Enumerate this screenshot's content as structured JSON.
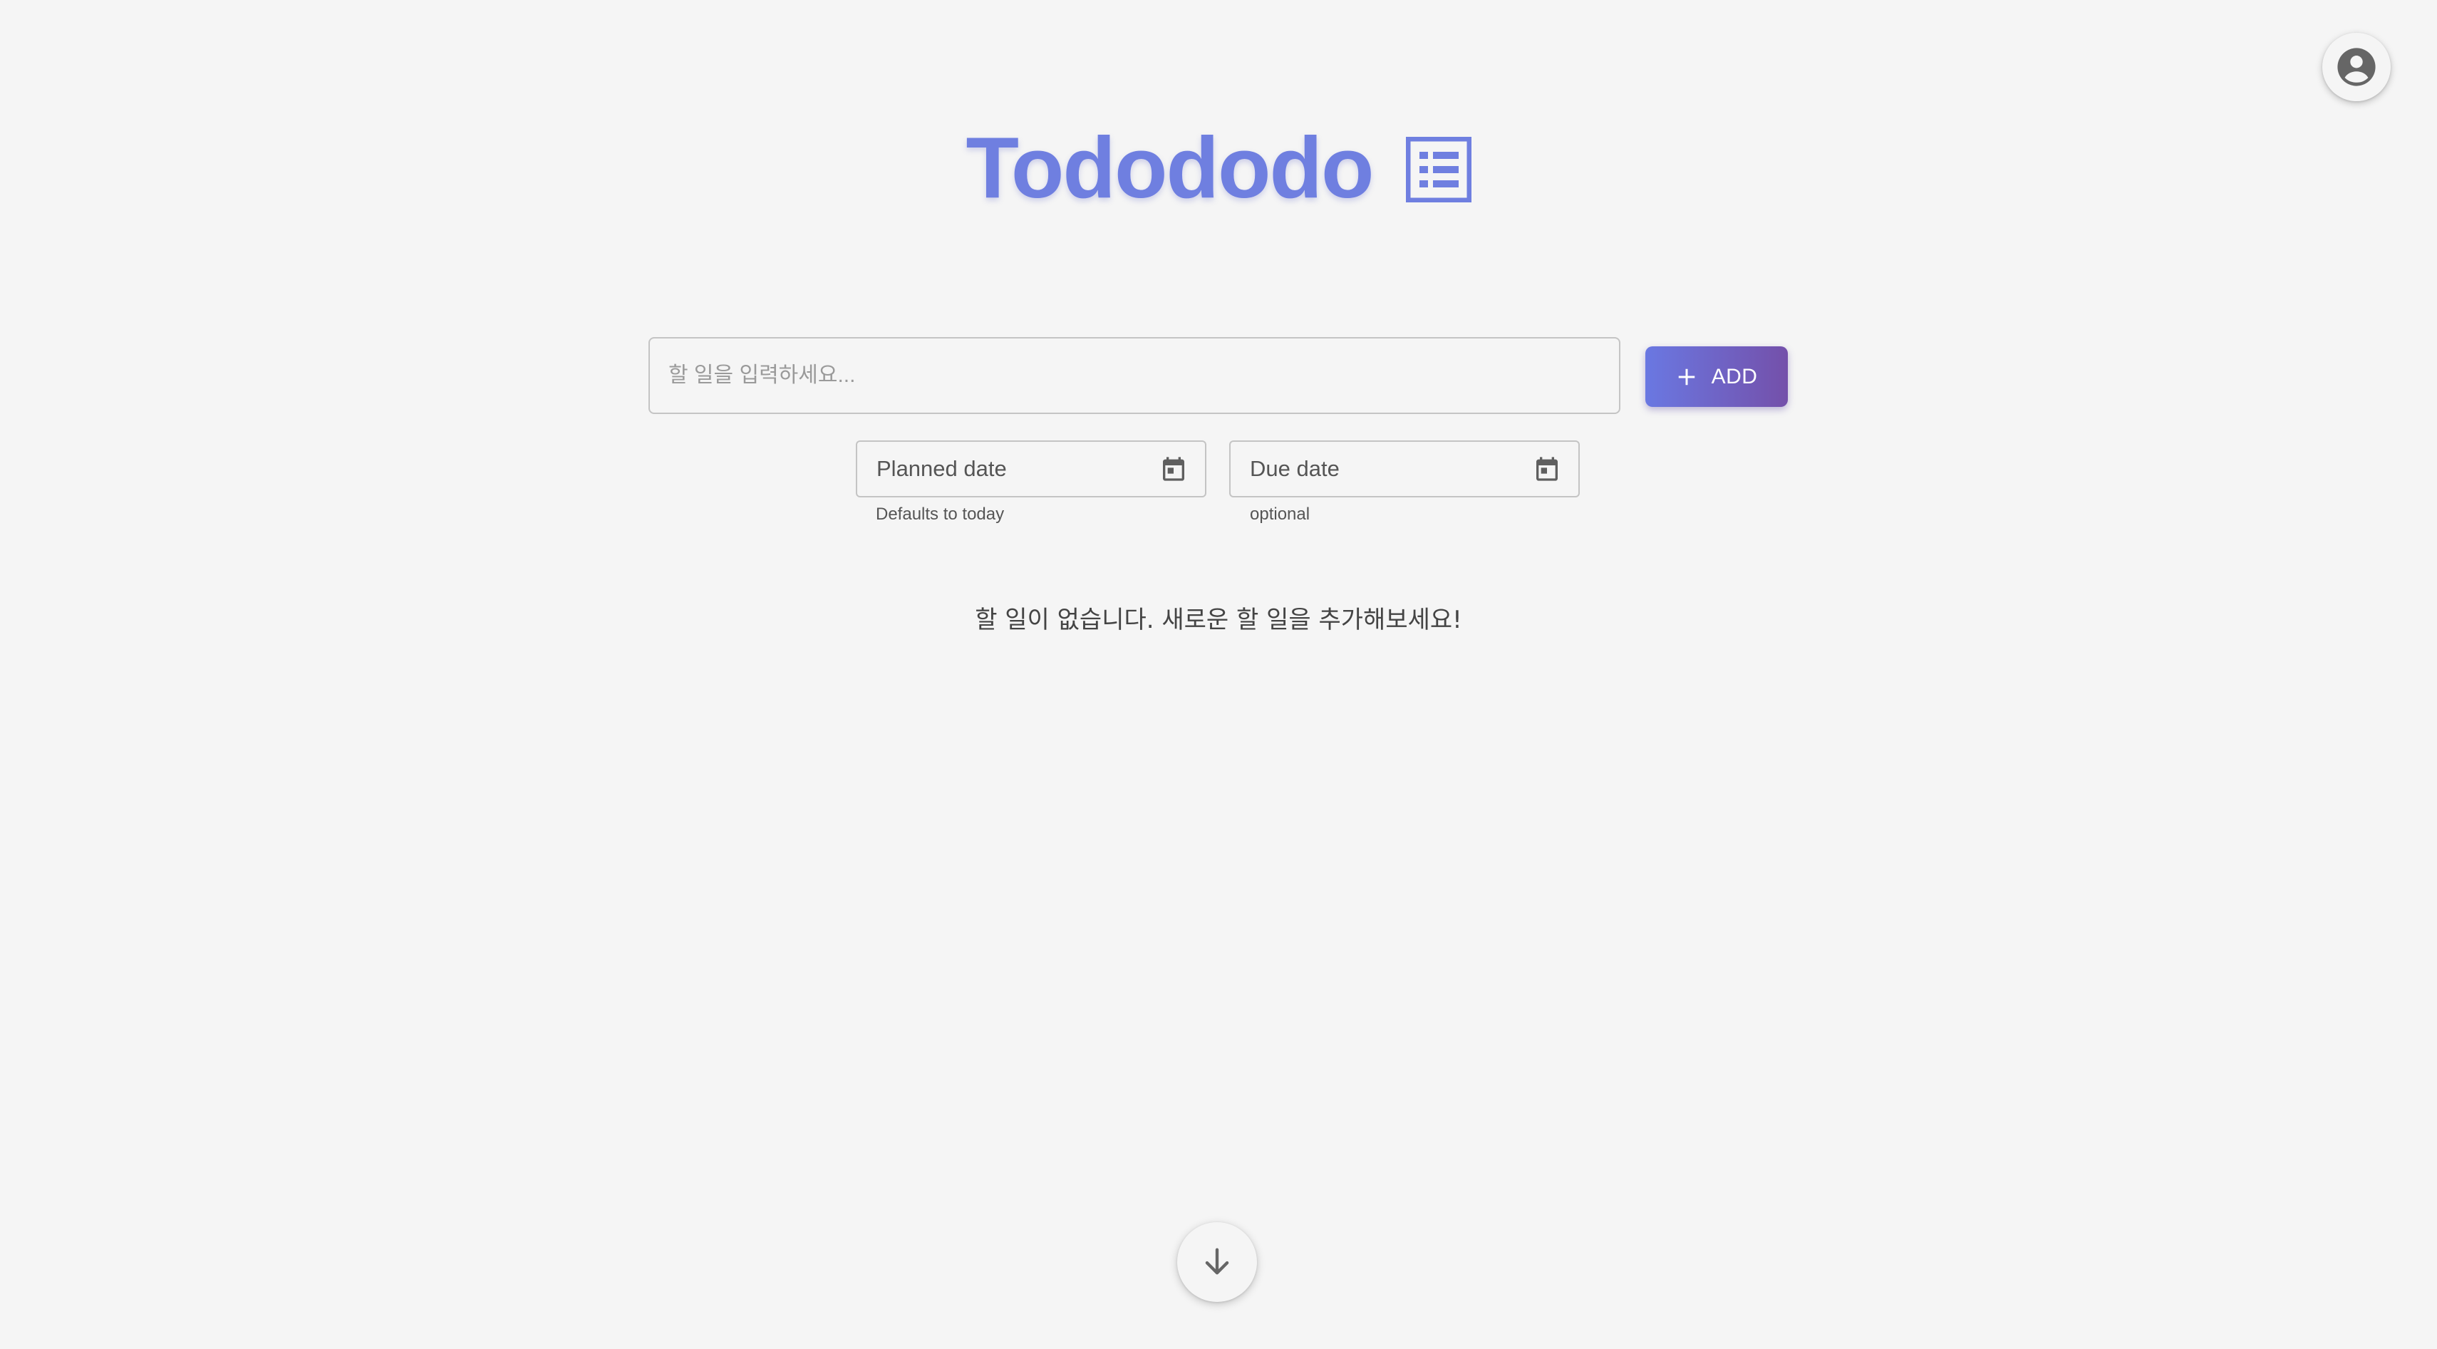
{
  "app": {
    "title": "Tododo",
    "title_display": "Todododo",
    "title_icon": "list-alt-icon",
    "accent_color": "#6f7fe0"
  },
  "header": {
    "account_icon": "account-circle-icon"
  },
  "todo_form": {
    "input_placeholder": "할 일을 입력하세요...",
    "input_value": "",
    "add_label": "ADD",
    "add_icon": "plus-icon",
    "add_gradient": [
      "#6a78e2",
      "#7450aa"
    ],
    "planned_date": {
      "label": "Planned date",
      "helper": "Defaults to today",
      "icon": "calendar-icon"
    },
    "due_date": {
      "label": "Due date",
      "helper": "optional",
      "icon": "calendar-icon"
    }
  },
  "todo_list": {
    "items": [],
    "empty_message": "할 일이 없습니다. 새로운 할 일을 추가해보세요!"
  },
  "footer": {
    "scroll_icon": "arrow-down-icon"
  }
}
